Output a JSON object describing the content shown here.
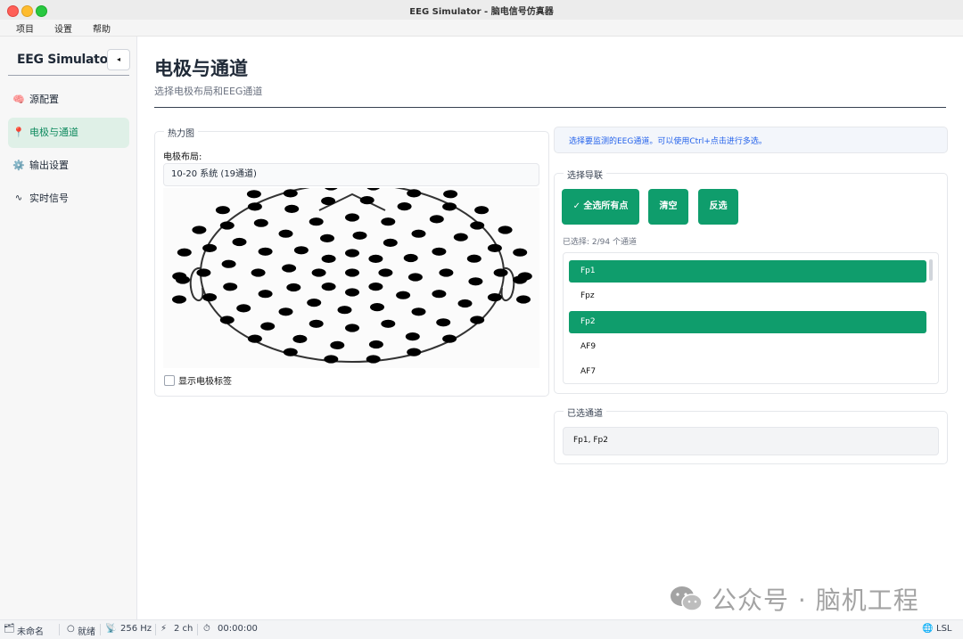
{
  "window": {
    "title": "EEG Simulator - 脑电信号仿真器"
  },
  "menu": [
    "项目",
    "设置",
    "帮助"
  ],
  "sidebar": {
    "brand": "EEG Simulator",
    "collapse_icon": "◂",
    "items": [
      {
        "label": "源配置",
        "icon": "brain-icon",
        "glyph": "🧠"
      },
      {
        "label": "电极与通道",
        "icon": "pin-icon",
        "glyph": "📍",
        "active": true
      },
      {
        "label": "输出设置",
        "icon": "gear-icon",
        "glyph": "⚙️"
      },
      {
        "label": "实时信号",
        "icon": "wave-icon",
        "glyph": "∿"
      }
    ]
  },
  "page": {
    "title": "电极与通道",
    "subtitle": "选择电极布局和EEG通道"
  },
  "heatmap": {
    "group_title": "热力图",
    "layout_label": "电极布局:",
    "layout_value": "10-20 系统 (19通道)",
    "show_labels": "显示电极标签"
  },
  "channels": {
    "info": "选择要监测的EEG通道。可以使用Ctrl+点击进行多选。",
    "group_title": "选择导联",
    "buttons": {
      "select_all": "✓ 全选所有点",
      "clear": "清空",
      "invert": "反选"
    },
    "selected_count": "已选择: 2/94 个通道",
    "list": [
      {
        "name": "Fp1",
        "selected": true
      },
      {
        "name": "Fpz",
        "selected": false
      },
      {
        "name": "Fp2",
        "selected": true
      },
      {
        "name": "AF9",
        "selected": false
      },
      {
        "name": "AF7",
        "selected": false
      }
    ],
    "selected_group_title": "已选通道",
    "selected_value": "Fp1, Fp2"
  },
  "status": {
    "file": "未命名",
    "state": "就绪",
    "rate": "256 Hz",
    "channels": "2 ch",
    "time": "00:00:00",
    "stream": "LSL"
  },
  "watermark": "公众号 · 脑机工程",
  "colors": {
    "accent": "#0f9d6c",
    "info_text": "#2563eb"
  }
}
